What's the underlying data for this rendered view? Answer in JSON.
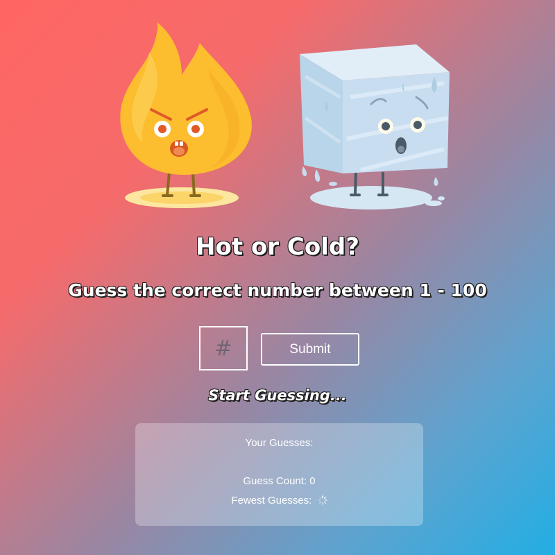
{
  "header": {
    "title": "Hot or Cold?",
    "subtitle": "Guess the correct number between 1 - 100"
  },
  "illustration": {
    "characters": [
      "fire-character",
      "ice-cube-character"
    ]
  },
  "form": {
    "input_placeholder": "#",
    "input_value": "",
    "submit_label": "Submit"
  },
  "status": {
    "message": "Start Guessing..."
  },
  "stats": {
    "guesses_label": "Your Guesses:",
    "guesses": [],
    "count_label": "Guess Count:",
    "count_value": "0",
    "fewest_label": "Fewest Guesses:",
    "fewest_icon": "loading-spinner-icon"
  },
  "colors": {
    "hot": "#ff6663",
    "cold": "#22aee4",
    "flame": "#fbbf3a",
    "ice": "#c9dfee"
  }
}
